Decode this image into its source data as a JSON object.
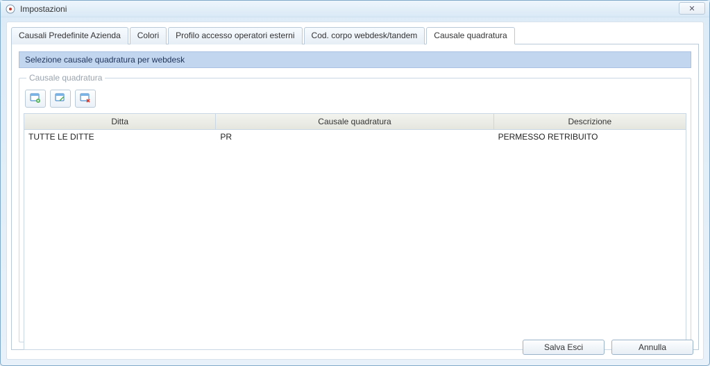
{
  "window": {
    "title": "Impostazioni",
    "close_glyph": "✕"
  },
  "tabs": [
    {
      "label": "Causali Predefinite Azienda"
    },
    {
      "label": "Colori"
    },
    {
      "label": "Profilo accesso operatori esterni"
    },
    {
      "label": "Cod. corpo webdesk/tandem"
    },
    {
      "label": "Causale quadratura"
    }
  ],
  "banner": "Selezione causale quadratura per webdesk",
  "groupbox_legend": "Causale quadratura",
  "toolbar_icons": {
    "add": "add-icon",
    "edit": "edit-icon",
    "delete": "delete-icon"
  },
  "grid": {
    "headers": {
      "ditta": "Ditta",
      "causale": "Causale quadratura",
      "descrizione": "Descrizione"
    },
    "rows": [
      {
        "ditta": "TUTTE LE DITTE",
        "causale": "PR",
        "descrizione": "PERMESSO RETRIBUITO"
      }
    ]
  },
  "buttons": {
    "save_exit": "Salva Esci",
    "cancel": "Annulla"
  }
}
